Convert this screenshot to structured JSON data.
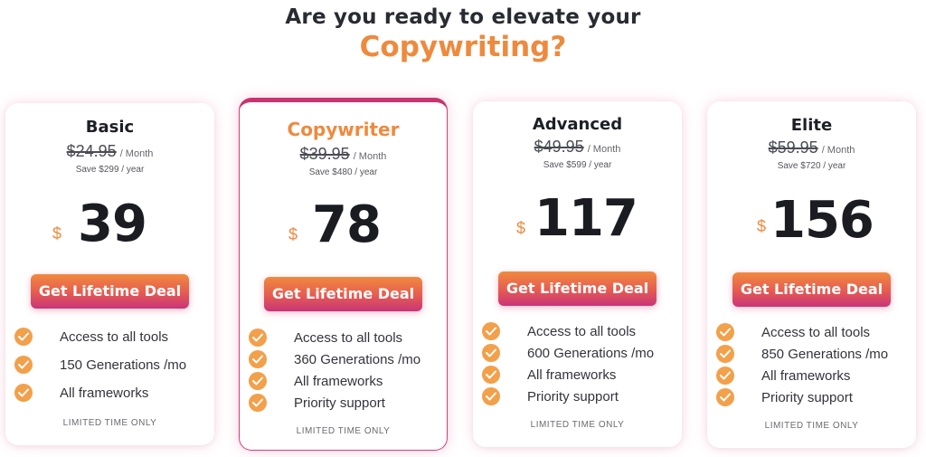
{
  "heading": {
    "line1": "Are you ready to elevate your",
    "line2": "Copywriting?"
  },
  "colors": {
    "accent": "#ee8a3e",
    "featured_border": "#c9336f",
    "check": "#f2a04a",
    "cta_gradient": [
      "#f08a3e",
      "#e65a52",
      "#c8357a"
    ]
  },
  "plans": [
    {
      "name": "Basic",
      "old_price": "$24.95",
      "per": "/ Month",
      "save": "Save $299 / year",
      "currency": "$",
      "price": "39",
      "cta": "Get Lifetime Deal",
      "features": [
        "Access to all tools",
        "150 Generations /mo",
        "All frameworks"
      ],
      "limited": "LIMITED TIME ONLY",
      "featured": false
    },
    {
      "name": "Copywriter",
      "old_price": "$39.95",
      "per": "/ Month",
      "save": "Save $480 / year",
      "currency": "$",
      "price": "78",
      "cta": "Get Lifetime Deal",
      "features": [
        "Access to all tools",
        "360 Generations /mo",
        "All frameworks",
        "Priority support"
      ],
      "limited": "LIMITED TIME ONLY",
      "featured": true
    },
    {
      "name": "Advanced",
      "old_price": "$49.95",
      "per": "/ Month",
      "save": "Save $599 / year",
      "currency": "$",
      "price": "117",
      "cta": "Get Lifetime Deal",
      "features": [
        "Access to all tools",
        "600 Generations /mo",
        "All frameworks",
        "Priority support"
      ],
      "limited": "LIMITED TIME ONLY",
      "featured": false
    },
    {
      "name": "Elite",
      "old_price": "$59.95",
      "per": "/ Month",
      "save": "Save $720 / year",
      "currency": "$",
      "price": "156",
      "cta": "Get Lifetime Deal",
      "features": [
        "Access to all tools",
        "850 Generations /mo",
        "All frameworks",
        "Priority support"
      ],
      "limited": "LIMITED TIME ONLY",
      "featured": false
    }
  ]
}
